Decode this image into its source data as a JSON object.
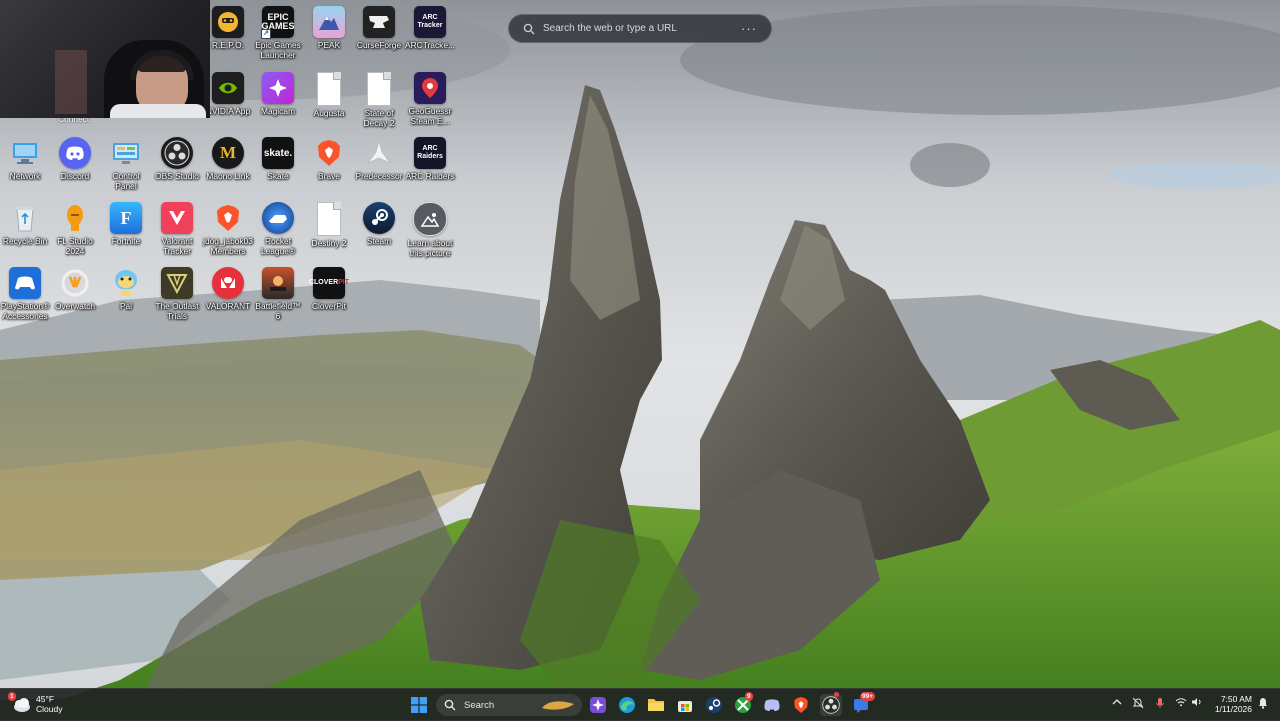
{
  "browser": {
    "search_placeholder": "Search the web or type a URL",
    "more_icon": "more-icon"
  },
  "desktop": {
    "icons": [
      {
        "label": "R.E.P.O.",
        "icon": "repo-icon"
      },
      {
        "label": "Epic Games Launcher",
        "icon": "epic-games-icon"
      },
      {
        "label": "PEAK",
        "icon": "peak-icon"
      },
      {
        "label": "CurseForge",
        "icon": "curseforge-icon"
      },
      {
        "label": "ARCTracke...",
        "icon": "arc-tracker-icon"
      },
      {
        "label": "NVIDIA App",
        "icon": "nvidia-icon"
      },
      {
        "label": "Magicam",
        "icon": "magicam-icon"
      },
      {
        "label": "Augusta",
        "icon": "file-icon"
      },
      {
        "label": "State of Decay 2",
        "icon": "file-icon"
      },
      {
        "label": "GeoGuessr Steam E...",
        "icon": "geoguessr-icon"
      },
      {
        "label": "Network",
        "icon": "network-icon"
      },
      {
        "label": "Discord",
        "icon": "discord-icon"
      },
      {
        "label": "Control Panel",
        "icon": "control-panel-icon"
      },
      {
        "label": "OBS Studio",
        "icon": "obs-icon"
      },
      {
        "label": "Maono Link",
        "icon": "maono-icon"
      },
      {
        "label": "Skate",
        "icon": "skate-icon"
      },
      {
        "label": "Brave",
        "icon": "brave-icon"
      },
      {
        "label": "Predecessor",
        "icon": "predecessor-icon"
      },
      {
        "label": "ARC Raiders",
        "icon": "arc-raiders-icon"
      },
      {
        "label": "Recycle Bin",
        "icon": "recycle-bin-icon"
      },
      {
        "label": "FL Studio 2024",
        "icon": "fl-studio-icon"
      },
      {
        "label": "Fortnite",
        "icon": "fortnite-icon"
      },
      {
        "label": "Valorant Tracker",
        "icon": "valorant-tracker-icon"
      },
      {
        "label": "jdog_jabok03 Members",
        "icon": "brave-icon"
      },
      {
        "label": "Rocket League®",
        "icon": "rocket-league-icon"
      },
      {
        "label": "Destiny 2",
        "icon": "file-icon"
      },
      {
        "label": "Steam",
        "icon": "steam-icon"
      },
      {
        "label": "Learn about this picture",
        "icon": "learn-picture-icon"
      },
      {
        "label": "PlayStation® Accessories",
        "icon": "playstation-icon"
      },
      {
        "label": "Overwatch",
        "icon": "overwatch-icon"
      },
      {
        "label": "Pal",
        "icon": "pal-icon"
      },
      {
        "label": "The Outlast Trials",
        "icon": "outlast-icon"
      },
      {
        "label": "VALORANT",
        "icon": "valorant-icon"
      },
      {
        "label": "Battlefield™ 6",
        "icon": "battlefield-icon"
      },
      {
        "label": "CloverPit",
        "icon": "cloverpit-icon"
      }
    ],
    "partial_label": "Connect"
  },
  "taskbar": {
    "weather": {
      "temp": "45°F",
      "condition": "Cloudy",
      "alert_badge": "1"
    },
    "search_label": "Search",
    "apps": [
      {
        "name": "start",
        "icon": "windows-start-icon"
      },
      {
        "name": "copilot",
        "icon": "copilot-icon"
      },
      {
        "name": "edge",
        "icon": "edge-icon"
      },
      {
        "name": "file-explorer",
        "icon": "folder-icon"
      },
      {
        "name": "store",
        "icon": "store-icon"
      },
      {
        "name": "steam",
        "icon": "steam-icon"
      },
      {
        "name": "xbox",
        "icon": "xbox-icon",
        "badge": "9"
      },
      {
        "name": "discord",
        "icon": "discord-icon"
      },
      {
        "name": "brave",
        "icon": "brave-icon"
      },
      {
        "name": "obs",
        "icon": "obs-icon"
      },
      {
        "name": "messenger",
        "icon": "messenger-icon",
        "badge": "99+"
      }
    ],
    "tray": {
      "chevron": "chevron-up-icon",
      "time": "7:50 AM",
      "date": "1/11/2026"
    }
  },
  "colors": {
    "taskbar_bg": "#202422",
    "badge_red": "#e34242",
    "accent_blue": "#0078d4"
  }
}
